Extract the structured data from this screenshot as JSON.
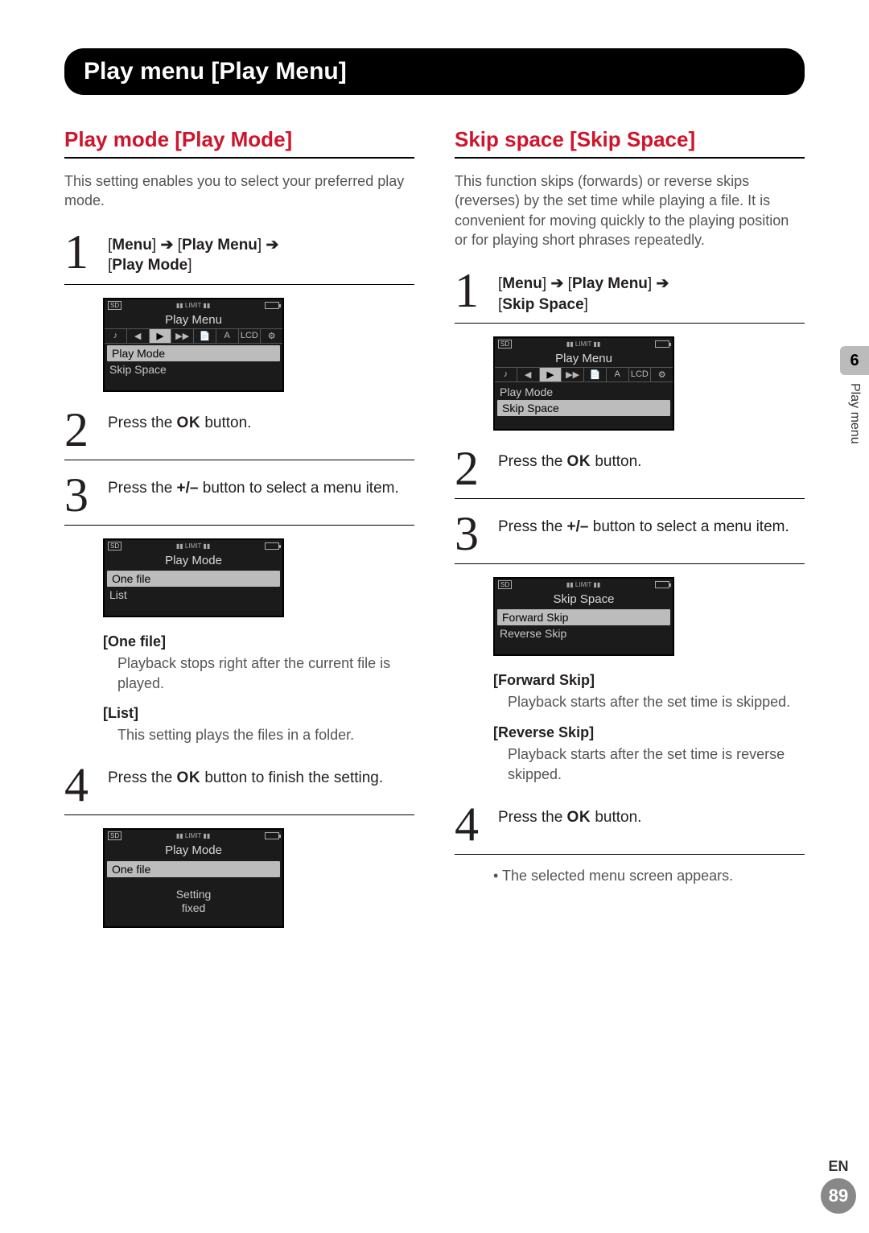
{
  "page_header": "Play menu [Play Menu]",
  "side": {
    "chapter": "6",
    "label": "Play menu"
  },
  "footer": {
    "lang": "EN",
    "page": "89"
  },
  "left": {
    "title": "Play mode [Play Mode]",
    "intro": "This setting enables you to select your preferred play mode.",
    "steps": {
      "s1": {
        "num": "1",
        "parts": [
          "[",
          "Menu",
          "] ",
          "➔",
          " [",
          "Play Menu",
          "] ",
          "➔",
          " [",
          "Play Mode",
          "]"
        ]
      },
      "s2": {
        "num": "2",
        "prefix": "Press the ",
        "ok": "OK",
        "suffix": " button."
      },
      "s3": {
        "num": "3",
        "prefix": "Press the ",
        "pm": "+/–",
        "suffix": " button to select a menu item."
      },
      "s4": {
        "num": "4",
        "prefix": "Press the ",
        "ok": "OK",
        "suffix": " button to finish the setting."
      }
    },
    "lcd1": {
      "title": "Play Menu",
      "tabs": [
        "♪",
        "◀",
        "▶",
        "▶▶",
        "📄",
        "A",
        "LCD",
        "⚙"
      ],
      "active_tab_index": 2,
      "items": [
        "Play Mode",
        "Skip Space"
      ],
      "selected_index": 0
    },
    "lcd2": {
      "title": "Play Mode",
      "items": [
        "One file",
        "List"
      ],
      "selected_index": 0
    },
    "lcd3": {
      "title": "Play Mode",
      "items": [
        "One file"
      ],
      "selected_index": 0,
      "sub": "Setting\nfixed"
    },
    "options": {
      "o1": {
        "label": "[One file]",
        "desc": "Playback stops right after the current file is played."
      },
      "o2": {
        "label": "[List]",
        "desc": "This setting plays the files in a folder."
      }
    }
  },
  "right": {
    "title": "Skip space [Skip Space]",
    "intro": "This function skips (forwards) or reverse skips (reverses) by the set time while playing a file. It is convenient for moving quickly to the playing position or for playing short phrases repeatedly.",
    "steps": {
      "s1": {
        "num": "1",
        "parts": [
          "[",
          "Menu",
          "] ",
          "➔",
          " [",
          "Play Menu",
          "] ",
          "➔",
          " [",
          "Skip Space",
          "]"
        ]
      },
      "s2": {
        "num": "2",
        "prefix": "Press the ",
        "ok": "OK",
        "suffix": " button."
      },
      "s3": {
        "num": "3",
        "prefix": "Press the ",
        "pm": "+/–",
        "suffix": " button to select a menu item."
      },
      "s4": {
        "num": "4",
        "prefix": "Press the ",
        "ok": "OK",
        "suffix": " button."
      }
    },
    "lcd1": {
      "title": "Play Menu",
      "tabs": [
        "♪",
        "◀",
        "▶",
        "▶▶",
        "📄",
        "A",
        "LCD",
        "⚙"
      ],
      "active_tab_index": 2,
      "items": [
        "Play Mode",
        "Skip Space"
      ],
      "selected_index": 1
    },
    "lcd2": {
      "title": "Skip Space",
      "items": [
        "Forward Skip",
        "Reverse Skip"
      ],
      "selected_index": 0
    },
    "options": {
      "o1": {
        "label": "[Forward Skip]",
        "desc": "Playback starts after the set time is skipped."
      },
      "o2": {
        "label": "[Reverse Skip]",
        "desc": "Playback starts after the set time is reverse skipped."
      }
    },
    "note": "The selected menu screen appears."
  }
}
